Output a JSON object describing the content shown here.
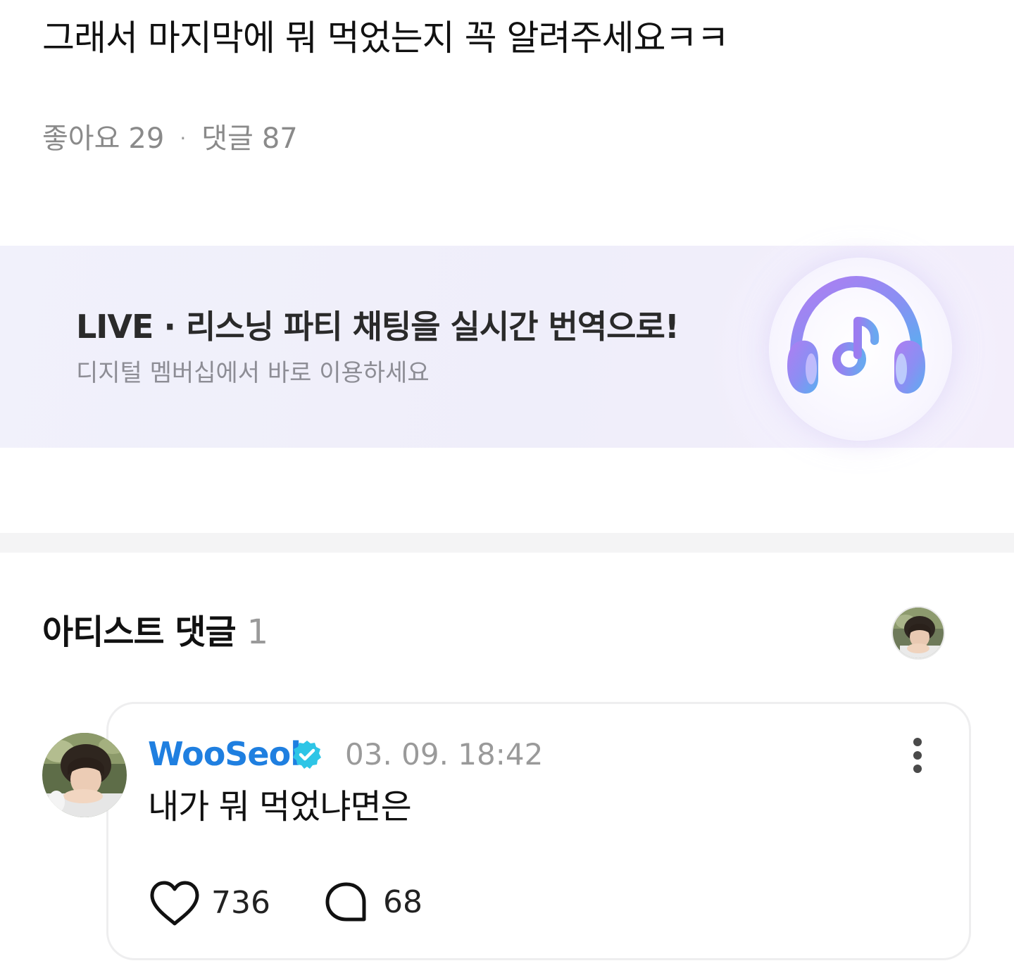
{
  "post": {
    "body": "그래서 마지막에 뭐 먹었는지 꼭 알려주세요ㅋㅋ",
    "likes_label": "좋아요",
    "likes_count": "29",
    "separator": "·",
    "comments_label": "댓글",
    "comments_count": "87"
  },
  "banner": {
    "title": "LIVE · 리스닝 파티 채팅을 실시간 번역으로!",
    "subtitle": "디지털 멤버십에서 바로 이용하세요",
    "icon": "headphones-music-icon"
  },
  "artist_comments": {
    "title": "아티스트 댓글",
    "count": "1"
  },
  "comment": {
    "author": "WooSeok",
    "verified_icon": "verified-badge-icon",
    "timestamp": "03. 09. 18:42",
    "text": "내가 뭐 먹었냐면은",
    "like_count": "736",
    "reply_count": "68",
    "like_icon": "heart-icon",
    "reply_icon": "speech-bubble-icon",
    "more_icon": "more-vertical-icon"
  },
  "colors": {
    "author": "#1f7fe0",
    "verified": "#2ec5e6",
    "muted": "#8a8a8a",
    "banner_bg": "#f0effa"
  }
}
